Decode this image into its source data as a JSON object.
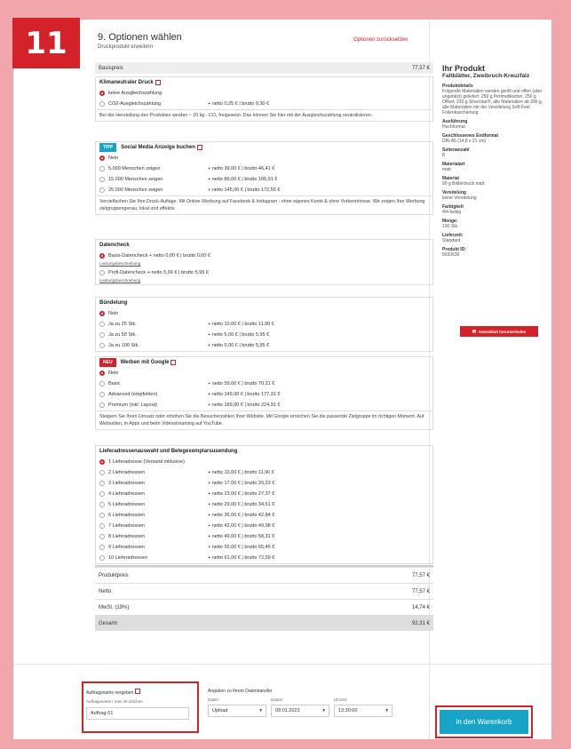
{
  "step_badge": "11",
  "header": {
    "title": "9. Optionen wählen",
    "subtitle": "Druckprodukt erweitern",
    "reset": "Optionen zurücksetzen"
  },
  "basispreis": {
    "label": "Basispreis",
    "value": "77,57 €"
  },
  "klima": {
    "title": "Klimaneutraler Druck",
    "options": [
      {
        "label": "keine Ausgleichszahlung",
        "price": ""
      },
      {
        "label": "CO2-Ausgleichszahlung",
        "price": "+ netto 0,25 € | brutto 0,30 €"
      }
    ],
    "desc": "Bei der Herstellung des Produktes werden ~ 20 kg - CO₂ freigesetzt. Das können Sie hier mit der Ausgleichszahlung neutralisieren."
  },
  "social": {
    "tag": "TIPP",
    "title": "Social Media Anzeige buchen",
    "options": [
      {
        "label": "Nein",
        "price": ""
      },
      {
        "label": "5.000 Menschen zeigen",
        "price": "+ netto 39,00 € | brutto 46,41 €"
      },
      {
        "label": "15.000 Menschen zeigen",
        "price": "+ netto 89,00 € | brutto 105,91 €"
      },
      {
        "label": "25.000 Menschen zeigen",
        "price": "+ netto 145,00 € | brutto 172,55 €"
      }
    ],
    "desc": "Vervielfachen Sie Ihre Druck-Auflage. Mit Online-Werbung auf Facebook & Instagram - ohne eigenes Konto & ohne Vorkenntnisse. Wir zeigen Ihre Werbung zielgruppengenau, lokal und effektiv."
  },
  "datencheck": {
    "title": "Datencheck",
    "options": [
      {
        "label": "Basis-Datencheck + netto 0,00 € | brutto 0,00 €",
        "link": "Leistungsbeschreibung"
      },
      {
        "label": "Profi-Datencheck + netto 5,00 € | brutto 5,95 €",
        "link": "Leistungsbeschreibung"
      }
    ]
  },
  "buendelung": {
    "title": "Bündelung",
    "options": [
      {
        "label": "Nein",
        "price": ""
      },
      {
        "label": "Ja zu 25 Stk.",
        "price": "+ netto 10,00 € | brutto 11,90 €"
      },
      {
        "label": "Ja zu 50 Stk.",
        "price": "+ netto 5,00 € | brutto 5,95 €"
      },
      {
        "label": "Ja zu 100 Stk.",
        "price": "+ netto 5,00 € | brutto 5,95 €"
      }
    ]
  },
  "google": {
    "tag": "NEU",
    "title": "Werben mit Google",
    "options": [
      {
        "label": "Nein",
        "price": ""
      },
      {
        "label": "Basic",
        "price": "+ netto 59,00 € | brutto 70,21 €"
      },
      {
        "label": "Advanced (empfohlen)",
        "price": "+ netto 149,00 € | brutto 177,31 €"
      },
      {
        "label": "Premium (inkl. Layout)",
        "price": "+ netto 189,00 € | brutto 224,91 €"
      }
    ],
    "desc": "Steigern Sie Ihren Umsatz oder erhöhen Sie die Besucherzahlen Ihrer Website. Mit Google erreichen Sie die passende Zielgruppe im richtigen Moment. Auf Webseiten, in Apps und beim Videostreaming auf YouTube."
  },
  "liefer": {
    "title": "Lieferadressenauswahl und Belegexemplarsusendung",
    "options": [
      {
        "label": "1 Lieferadresse (Versand inklusive)",
        "price": ""
      },
      {
        "label": "2 Lieferadressen",
        "price": "+ netto 10,00 € | brutto 11,90 €"
      },
      {
        "label": "3 Lieferadressen",
        "price": "+ netto 17,00 € | brutto 20,23 €"
      },
      {
        "label": "4 Lieferadressen",
        "price": "+ netto 23,00 € | brutto 27,37 €"
      },
      {
        "label": "5 Lieferadressen",
        "price": "+ netto 29,00 € | brutto 34,51 €"
      },
      {
        "label": "6 Lieferadressen",
        "price": "+ netto 36,00 € | brutto 42,84 €"
      },
      {
        "label": "7 Lieferadressen",
        "price": "+ netto 42,00 € | brutto 49,98 €"
      },
      {
        "label": "8 Lieferadressen",
        "price": "+ netto 49,00 € | brutto 58,31 €"
      },
      {
        "label": "9 Lieferadressen",
        "price": "+ netto 55,00 € | brutto 65,45 €"
      },
      {
        "label": "10 Lieferadressen",
        "price": "+ netto 61,00 € | brutto 72,59 €"
      }
    ]
  },
  "totals": [
    {
      "label": "Produktpreis",
      "value": "77,57 €"
    },
    {
      "label": "Netto",
      "value": "77,57 €"
    },
    {
      "label": "MwSt. (19%)",
      "value": "14,74 €"
    },
    {
      "label": "Gesamt",
      "value": "92,31 €"
    }
  ],
  "sidebar": {
    "title": "Ihr Produkt",
    "subtitle": "Faltblätter, Zweibruch-Kreuzfalz",
    "details": [
      {
        "label": "Produktdetails",
        "value": "Folgende Materialien werden gerillt und offen (also ungefalzt) geliefert: 250 g Perlmuttkarton, 250 g Offset, 230 g Silverstar®, alle Materialien ab 285 g, alle Materialien mit der Veredelung Soft-Feel Folienkaschierung"
      },
      {
        "label": "Ausführung",
        "value": "Hochformat"
      },
      {
        "label": "Geschlossenes Endformat",
        "value": "DIN A5 (14,8 x 21 cm)"
      },
      {
        "label": "Seitenanzahl",
        "value": "8"
      },
      {
        "label": "Materialart",
        "value": "matt"
      },
      {
        "label": "Material",
        "value": "90 g Bilderdruck matt"
      },
      {
        "label": "Veredelung",
        "value": "keine Veredelung"
      },
      {
        "label": "Farbigkeit",
        "value": "4/4-farbig"
      },
      {
        "label": "Menge:",
        "value": "100 Stk."
      },
      {
        "label": "Lieferzeit:",
        "value": "Standard"
      },
      {
        "label": "Produkt ID:",
        "value": "9030630"
      }
    ],
    "download": "Datenblatt herunterladen"
  },
  "bottom": {
    "auftrag_label": "Auftragsname vergeben",
    "auftrag_sub": "Auftragsname / max.40 Zeichen",
    "auftrag_value": "Auftrag 01",
    "transfer_label": "Angaben zu Ihrem Datentransfer",
    "daten_label": "Daten",
    "daten_value": "Upload",
    "datum_label": "Datum",
    "datum_value": "09.01.2023",
    "uhrzeit_label": "Uhrzeit",
    "uhrzeit_value": "13:30:00",
    "cart": "in den Warenkorb"
  }
}
